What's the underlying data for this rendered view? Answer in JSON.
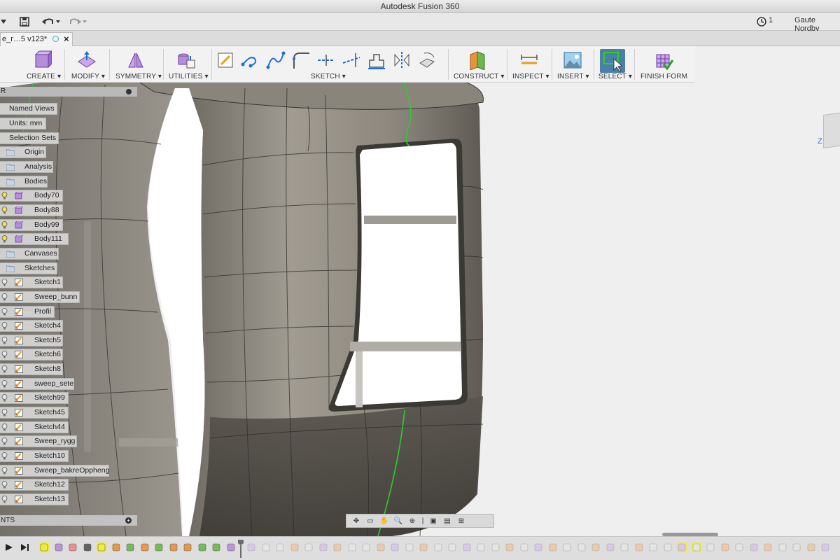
{
  "app": {
    "title": "Autodesk Fusion 360"
  },
  "quick_access": {
    "job_count": "1",
    "user_name": "Gaute Nordby"
  },
  "document_tab": {
    "name": "e_r…5 v123*"
  },
  "ribbon": {
    "groups": [
      {
        "label": "CREATE ▾"
      },
      {
        "label": "MODIFY ▾"
      },
      {
        "label": "SYMMETRY ▾"
      },
      {
        "label": "UTILITIES ▾"
      },
      {
        "label": "SKETCH ▾"
      },
      {
        "label": "CONSTRUCT ▾"
      },
      {
        "label": "INSPECT ▾"
      },
      {
        "label": "INSERT ▾"
      },
      {
        "label": "SELECT ▾"
      },
      {
        "label": "FINISH FORM"
      }
    ]
  },
  "browser": {
    "header": "R",
    "items": [
      {
        "label": "Named Views",
        "icon": "folder-icon",
        "bulb": false
      },
      {
        "label": "Units: mm",
        "icon": "document-icon",
        "bulb": false
      },
      {
        "label": "Selection Sets",
        "icon": "folder-icon",
        "bulb": false
      },
      {
        "label": "Origin",
        "icon": "folder-icon",
        "bulb": false
      },
      {
        "label": "Analysis",
        "icon": "folder-icon",
        "bulb": false
      },
      {
        "label": "Bodies",
        "icon": "folder-icon",
        "bulb": false
      },
      {
        "label": "Body70",
        "icon": "body-icon",
        "bulb": true
      },
      {
        "label": "Body88",
        "icon": "body-icon",
        "bulb": true
      },
      {
        "label": "Body99",
        "icon": "body-icon",
        "bulb": true
      },
      {
        "label": "Body111",
        "icon": "body-icon",
        "bulb": true
      },
      {
        "label": "Canvases",
        "icon": "folder-icon",
        "bulb": false
      },
      {
        "label": "Sketches",
        "icon": "folder-icon",
        "bulb": false
      },
      {
        "label": "Sketch1",
        "icon": "sketch-icon",
        "bulb": true
      },
      {
        "label": "Sweep_bunn",
        "icon": "sketch-icon",
        "bulb": true
      },
      {
        "label": "Profil",
        "icon": "sketch-icon",
        "bulb": true
      },
      {
        "label": "Sketch4",
        "icon": "sketch-icon",
        "bulb": true
      },
      {
        "label": "Sketch5",
        "icon": "sketch-icon",
        "bulb": true
      },
      {
        "label": "Sketch6",
        "icon": "sketch-icon",
        "bulb": true
      },
      {
        "label": "Sketch8",
        "icon": "sketch-icon",
        "bulb": true
      },
      {
        "label": "sweep_sete",
        "icon": "sketch-icon",
        "bulb": true
      },
      {
        "label": "Sketch99",
        "icon": "sketch-icon",
        "bulb": true
      },
      {
        "label": "Sketch45",
        "icon": "sketch-icon",
        "bulb": true
      },
      {
        "label": "Sketch44",
        "icon": "sketch-icon",
        "bulb": true
      },
      {
        "label": "Sweep_rygg",
        "icon": "sketch-icon",
        "bulb": true
      },
      {
        "label": "Sketch10",
        "icon": "sketch-icon",
        "bulb": true
      },
      {
        "label": "Sweep_bakreOppheng",
        "icon": "sketch-icon",
        "bulb": true
      },
      {
        "label": "Sketch12",
        "icon": "sketch-icon",
        "bulb": true
      },
      {
        "label": "Sketch13",
        "icon": "sketch-icon",
        "bulb": true
      }
    ]
  },
  "comments": {
    "header": "NTS"
  },
  "viewcube": {
    "axis_label": "Z"
  },
  "colors": {
    "accent": "#4a7fa8",
    "highlight": "#f0ee3a",
    "model": "#8f8a80",
    "edge_green": "#2ecc2e"
  }
}
